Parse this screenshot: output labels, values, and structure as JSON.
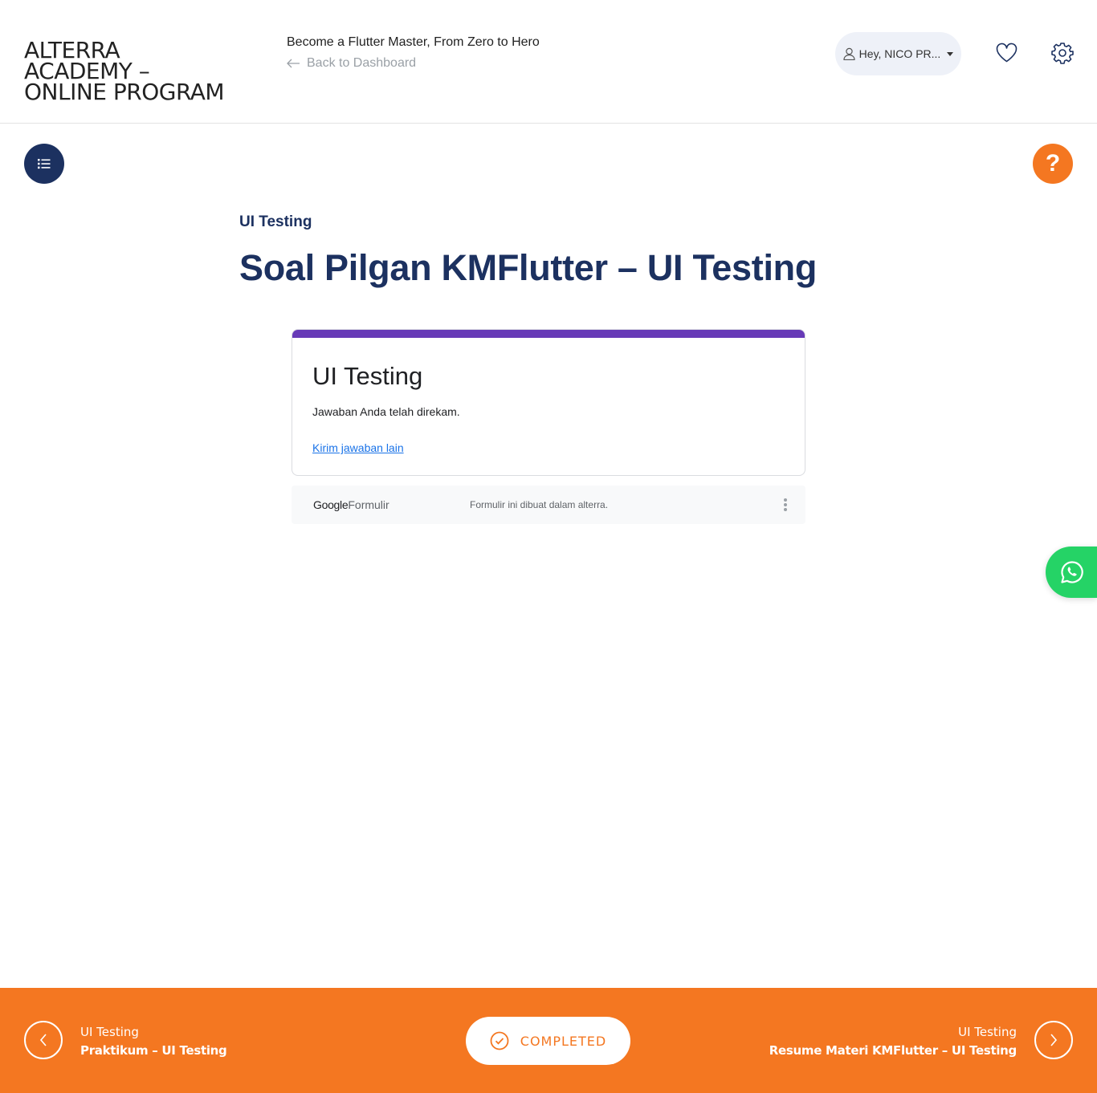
{
  "header": {
    "logo_lines": [
      "ALTERRA",
      "ACADEMY –",
      "ONLINE PROGRAM"
    ],
    "course_title": "Become a Flutter Master, From Zero to Hero",
    "back_link": "Back to Dashboard",
    "user_greeting": "Hey, NICO PR...",
    "icons": {
      "user": "user-icon",
      "wishlist": "heart-icon",
      "settings": "gear-icon"
    }
  },
  "actions": {
    "menu_icon": "list-icon",
    "help_label": "?"
  },
  "lesson": {
    "section": "UI Testing",
    "title": "Soal Pilgan KMFlutter – UI Testing"
  },
  "form": {
    "accent_color": "#673ab7",
    "title": "UI Testing",
    "message": "Jawaban Anda telah direkam.",
    "link": "Kirim jawaban lain",
    "footer_brand_google": "Google",
    "footer_brand_forms": "Formulir",
    "footer_note": "Formulir ini dibuat dalam alterra."
  },
  "whatsapp": {
    "icon": "whatsapp-icon",
    "color": "#25d366"
  },
  "footer_nav": {
    "color": "#f47721",
    "prev": {
      "section": "UI Testing",
      "title": "Praktikum – UI Testing"
    },
    "status": "COMPLETED",
    "next": {
      "section": "UI Testing",
      "title": "Resume Materi KMFlutter – UI Testing"
    }
  },
  "colors": {
    "navy": "#1c3160",
    "orange": "#f47721"
  }
}
